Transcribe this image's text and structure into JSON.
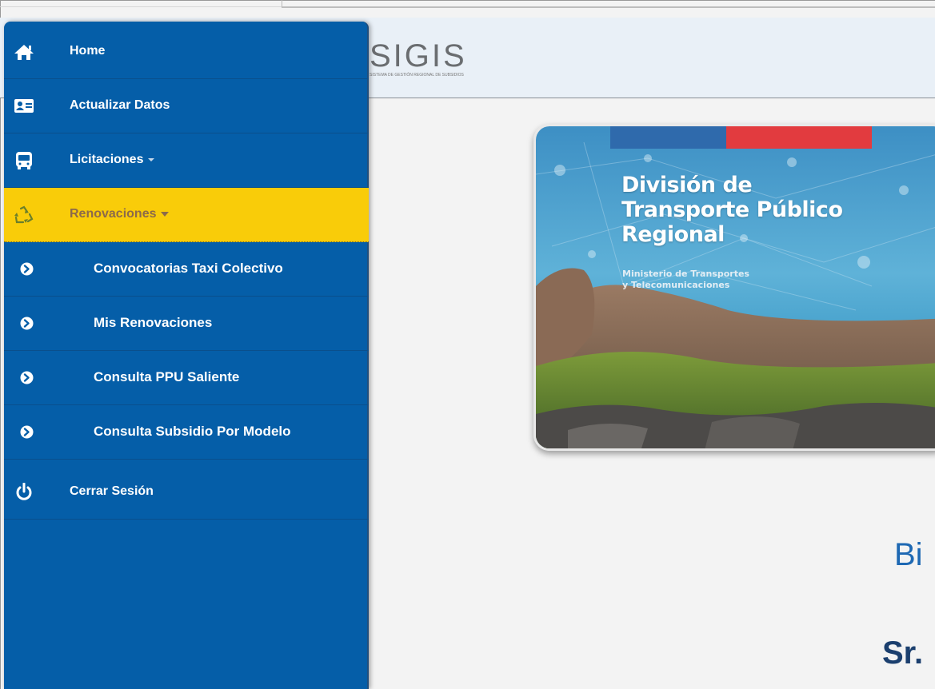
{
  "header": {
    "logo_text": "SIGIS",
    "logo_subtitle": "SISTEMA DE GESTIÓN REGIONAL DE SUBSIDIOS"
  },
  "sidebar": {
    "items": [
      {
        "label": "Home",
        "icon": "home-icon"
      },
      {
        "label": "Actualizar Datos",
        "icon": "id-card-icon"
      },
      {
        "label": "Licitaciones",
        "icon": "bus-icon",
        "has_dropdown": true
      },
      {
        "label": "Renovaciones",
        "icon": "recycle-icon",
        "has_dropdown": true,
        "active": true
      },
      {
        "label": "Convocatorias Taxi Colectivo",
        "icon": "arrow-circle-right-icon",
        "submenu": true
      },
      {
        "label": "Mis Renovaciones",
        "icon": "arrow-circle-right-icon",
        "submenu": true
      },
      {
        "label": "Consulta PPU Saliente",
        "icon": "arrow-circle-right-icon",
        "submenu": true
      },
      {
        "label": "Consulta Subsidio Por Modelo",
        "icon": "arrow-circle-right-icon",
        "submenu": true
      },
      {
        "label": "Cerrar Sesión",
        "icon": "power-icon"
      }
    ]
  },
  "banner": {
    "title_lines": [
      "División de",
      "Transporte Público",
      "Regional"
    ],
    "subtitle_lines": [
      "Ministerio de Transportes",
      "y Telecomunicaciones"
    ]
  },
  "main": {
    "welcome": "Bi",
    "greeting": "Sr."
  },
  "colors": {
    "sidebar_bg": "#055ea8",
    "active_item_bg": "#f9cc09",
    "header_bg": "#e9f0f7",
    "welcome_text": "#1d68b3",
    "flag_blue": "#2f6aac",
    "flag_red": "#e23b3f"
  }
}
